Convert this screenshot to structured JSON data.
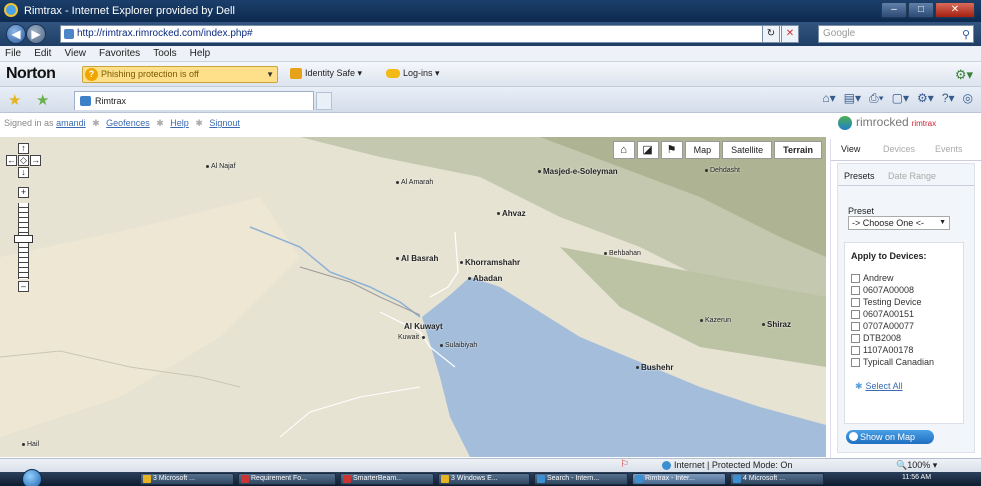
{
  "window": {
    "title": "Rimtrax - Internet Explorer provided by Dell"
  },
  "address_bar": {
    "url": "http://rimtrax.rimrocked.com/index.php#",
    "search_placeholder": "Google"
  },
  "menu": [
    "File",
    "Edit",
    "View",
    "Favorites",
    "Tools",
    "Help"
  ],
  "norton": {
    "brand": "Norton",
    "phishing": "Phishing protection is off",
    "identity_safe": "Identity Safe ▾",
    "logins": "Log-ins ▾"
  },
  "tabs": {
    "active_tab": "Rimtrax"
  },
  "page": {
    "signed_in_prefix": "Signed in as",
    "username": "amandi",
    "links": [
      "Geofences",
      "Help",
      "Signout"
    ],
    "logo_text": "rimrocked",
    "logo_sub": "rimtrax"
  },
  "map": {
    "types": [
      "Map",
      "Satellite",
      "Terrain"
    ],
    "selected_type": "Terrain",
    "places": {
      "al_najaf": "Al Najaf",
      "al_amarah": "Al Amarah",
      "masjed": "Masjed-e-Soleyman",
      "ahvaz": "Ahvaz",
      "al_basrah": "Al Basrah",
      "khorramshahr": "Khorramshahr",
      "abadan": "Abadan",
      "behbahan": "Behbahan",
      "al_kuwayt": "Al Kuwayt",
      "kuwait": "Kuwait",
      "shiraz": "Shiraz",
      "kazerun": "Kazerun",
      "bushehr": "Bushehr",
      "hail": "Hail",
      "dehdasht": "Dehdasht",
      "sulaibiyah": "Sulaibiyah"
    }
  },
  "panel": {
    "tabs": [
      "View",
      "Devices",
      "Events"
    ],
    "subtabs": [
      "Presets",
      "Date Range"
    ],
    "preset_label": "Preset",
    "preset_value": "-> Choose One <-",
    "apply_header": "Apply to Devices:",
    "devices": [
      "Andrew",
      "0607A00008",
      "Testing Device",
      "0607A00151",
      "0707A00077",
      "DTB2008",
      "1107A00178",
      "Typicall Canadian"
    ],
    "select_all": "Select All",
    "show_on_map": "Show on Map"
  },
  "status": {
    "zone": "Internet | Protected Mode: On",
    "zoom": "100%"
  },
  "taskbar": {
    "items": [
      "3 Microsoft ...",
      "Requirement Fo...",
      "SmarterBeam...",
      "3 Windows E...",
      "Search - Intern...",
      "Rimtrax - Inter...",
      "4 Microsoft ..."
    ],
    "time": "11:56 AM"
  },
  "colors": {
    "land": "#e7e4d6",
    "desert": "#efe9d8",
    "mountains": "#b9bfa6",
    "water": "#9fb8d8",
    "accent": "#1e6fc0"
  }
}
